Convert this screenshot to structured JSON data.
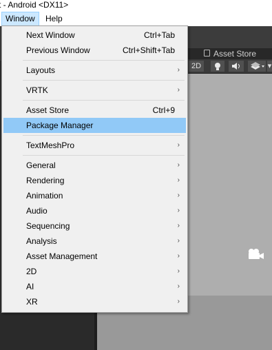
{
  "window": {
    "title": "t - Android <DX11>"
  },
  "menubar": {
    "items": [
      "Window",
      "Help"
    ]
  },
  "scene": {
    "asset_store_tab": "Asset Store",
    "toolbar": {
      "mode_2d": "2D",
      "more": "▾"
    }
  },
  "menu": {
    "groups": [
      [
        {
          "label": "Next Window",
          "shortcut": "Ctrl+Tab",
          "submenu": false
        },
        {
          "label": "Previous Window",
          "shortcut": "Ctrl+Shift+Tab",
          "submenu": false
        }
      ],
      [
        {
          "label": "Layouts",
          "shortcut": "",
          "submenu": true
        }
      ],
      [
        {
          "label": "VRTK",
          "shortcut": "",
          "submenu": true
        }
      ],
      [
        {
          "label": "Asset Store",
          "shortcut": "Ctrl+9",
          "submenu": false
        },
        {
          "label": "Package Manager",
          "shortcut": "",
          "submenu": false,
          "highlighted": true
        }
      ],
      [
        {
          "label": "TextMeshPro",
          "shortcut": "",
          "submenu": true
        }
      ],
      [
        {
          "label": "General",
          "shortcut": "",
          "submenu": true
        },
        {
          "label": "Rendering",
          "shortcut": "",
          "submenu": true
        },
        {
          "label": "Animation",
          "shortcut": "",
          "submenu": true
        },
        {
          "label": "Audio",
          "shortcut": "",
          "submenu": true
        },
        {
          "label": "Sequencing",
          "shortcut": "",
          "submenu": true
        },
        {
          "label": "Analysis",
          "shortcut": "",
          "submenu": true
        },
        {
          "label": "Asset Management",
          "shortcut": "",
          "submenu": true
        },
        {
          "label": "2D",
          "shortcut": "",
          "submenu": true
        },
        {
          "label": "AI",
          "shortcut": "",
          "submenu": true
        },
        {
          "label": "XR",
          "shortcut": "",
          "submenu": true
        }
      ]
    ],
    "submenu_arrow": "›"
  },
  "colors": {
    "highlight": "#91c9f7",
    "menu_bg": "#f0f0f0",
    "active_menubar": "#cce8ff",
    "scene_bg": "#aeaeae"
  },
  "icons": [
    "lock-icon",
    "light-icon",
    "audio-icon",
    "effects-icon",
    "camera-icon",
    "chevron-right-icon"
  ]
}
